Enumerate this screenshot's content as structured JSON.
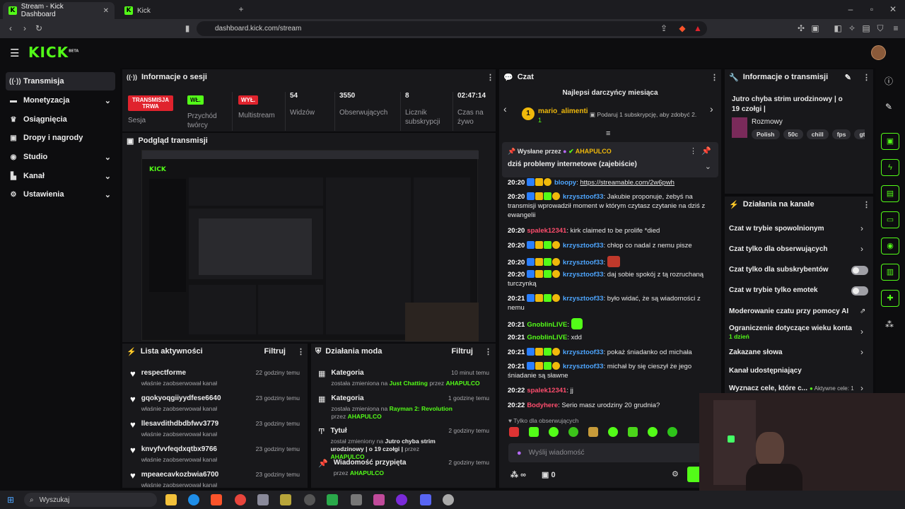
{
  "browser": {
    "tabs": [
      {
        "label": "Stream - Kick Dashboard"
      },
      {
        "label": "Kick"
      }
    ],
    "url": "dashboard.kick.com/stream"
  },
  "app": {
    "logo": "KICK",
    "logo_beta": "BETA"
  },
  "sidebar": {
    "items": [
      {
        "label": "Transmisja"
      },
      {
        "label": "Monetyzacja"
      },
      {
        "label": "Osiągnięcia"
      },
      {
        "label": "Dropy i nagrody"
      },
      {
        "label": "Studio"
      },
      {
        "label": "Kanał"
      },
      {
        "label": "Ustawienia"
      }
    ]
  },
  "session": {
    "title": "Informacje o sesji",
    "live_badge": "TRANSMISJA TRWA",
    "live_label": "Sesja",
    "creators_badge": "WŁ.",
    "creators_label": "Przychód twórcy",
    "multistream_badge": "WYŁ.",
    "multistream_label": "Multistream",
    "stats": [
      {
        "value": "54",
        "label": "Widzów"
      },
      {
        "value": "3550",
        "label": "Obserwujących"
      },
      {
        "value": "8",
        "label": "Licznik subskrypcji"
      },
      {
        "value": "02:47:14",
        "label": "Czas na żywo"
      }
    ]
  },
  "preview": {
    "title": "Podgląd transmisji"
  },
  "activity": {
    "title": "Lista aktywności",
    "filter": "Filtruj",
    "items": [
      {
        "name": "respectforme",
        "action": "właśnie zaobserwował kanał",
        "time": "22 godziny temu"
      },
      {
        "name": "gqokyoqgiiyydfese6640",
        "action": "właśnie zaobserwował kanał",
        "time": "23 godziny temu"
      },
      {
        "name": "llesavdithdbdbfwv3779",
        "action": "właśnie zaobserwował kanał",
        "time": "23 godziny temu"
      },
      {
        "name": "knvyfvvfeqdxqtbx9766",
        "action": "właśnie zaobserwował kanał",
        "time": "23 godziny temu"
      },
      {
        "name": "mpeaecavkozbwia6700",
        "action": "właśnie zaobserwował kanał",
        "time": "23 godziny temu"
      }
    ]
  },
  "mod": {
    "title": "Działania moda",
    "filter": "Filtruj",
    "items": [
      {
        "title": "Kategoria",
        "time": "10 minut temu",
        "pre": "została zmieniona na",
        "target": "Just Chatting",
        "mid": "przez",
        "by": "AHAPULCO"
      },
      {
        "title": "Kategoria",
        "time": "1 godzinę temu",
        "pre": "została zmieniona na",
        "target": "Rayman 2: Revolution",
        "mid": "przez",
        "by": "AHAPULCO"
      },
      {
        "title": "Tytuł",
        "time": "2 godziny temu",
        "pre": "został zmieniony na",
        "target": "Jutro chyba strim urodzinowy | o 19 czołgi |",
        "mid": "przez",
        "by": "AHAPULCO"
      },
      {
        "title": "Wiadomość przypięta",
        "time": "2 godziny temu",
        "pre": "przez",
        "target": "",
        "mid": "",
        "by": "AHAPULCO"
      }
    ]
  },
  "chat": {
    "title": "Czat",
    "top_gifters": "Najlepsi darczyńcy miesiąca",
    "gifter_name": "mario_alimenti",
    "gifter_count": "1",
    "gift_cta": "Podaruj 1 subskrypcję, aby zdobyć 2.",
    "pinned_label": "Wysłane przez",
    "pinned_by": "AHAPULCO",
    "pinned_text": "dziś problemy internetowe (zajebiście)",
    "messages": [
      {
        "time": "20:20",
        "user": "bloopy",
        "text": "https://streamable.com/2w6pwh"
      },
      {
        "time": "20:20",
        "user": "krzysztoof33",
        "text": "Jakubie proponuje, żebyś na transmisji wprowadził moment w którym czytasz czytanie na dziś z ewangelii"
      },
      {
        "time": "20:20",
        "user": "spalek12341",
        "text": "kirk claimed to be prolife *died"
      },
      {
        "time": "20:20",
        "user": "krzysztoof33",
        "text": "chłop co nadal z nemu pisze"
      },
      {
        "time": "20:20",
        "user": "krzysztoof33",
        "text": ""
      },
      {
        "time": "20:20",
        "user": "krzysztoof33",
        "text": "daj sobie spokój z tą rozruchaną turczynką"
      },
      {
        "time": "20:21",
        "user": "krzysztoof33",
        "text": "było widać, że są wiadomości z nemu"
      },
      {
        "time": "20:21",
        "user": "GnoblinLIVE",
        "text": ""
      },
      {
        "time": "20:21",
        "user": "GnoblinLIVE",
        "text": "xdd"
      },
      {
        "time": "20:21",
        "user": "krzysztoof33",
        "text": "pokaż śniadanko od michała"
      },
      {
        "time": "20:21",
        "user": "krzysztoof33",
        "text": "michał by się cieszył że jego śniadanie są sławne"
      },
      {
        "time": "20:22",
        "user": "spalek12341",
        "text": "jj"
      },
      {
        "time": "20:22",
        "user": "Bodyhere",
        "text": "Serio masz urodziny 20 grudnia?"
      }
    ],
    "followers_only": "Tylko dla obserwujących",
    "input_placeholder": "Wyślij wiadomość",
    "points": "0",
    "infinity": "∞"
  },
  "stream_info": {
    "title": "Informacje o transmisji",
    "stream_title": "Jutro chyba strim urodzinowy | o 19 czołgi |",
    "category": "Rozmowy",
    "tags": [
      "Polish",
      "50c",
      "chill",
      "fps",
      "gta"
    ]
  },
  "channel_actions": {
    "title": "Działania na kanale",
    "items": [
      {
        "label": "Czat w trybie spowolnionym"
      },
      {
        "label": "Czat tylko dla obserwujących"
      },
      {
        "label": "Czat tylko dla subskrybentów"
      },
      {
        "label": "Czat w trybie tylko emotek"
      },
      {
        "label": "Moderowanie czatu przy pomocy AI"
      },
      {
        "label": "Ograniczenie dotyczące wieku konta",
        "sub": "1 dzień"
      },
      {
        "label": "Zakazane słowa"
      },
      {
        "label": "Kanał udostępniający"
      },
      {
        "label": "Wyznacz cele, które c...",
        "sub": "Aktywne cele: 1"
      }
    ]
  },
  "taskbar": {
    "search": "Wyszukaj"
  },
  "colors": {
    "accent": "#53fc18",
    "live_red": "#e0232d",
    "link_blue": "#4ea6ff"
  }
}
